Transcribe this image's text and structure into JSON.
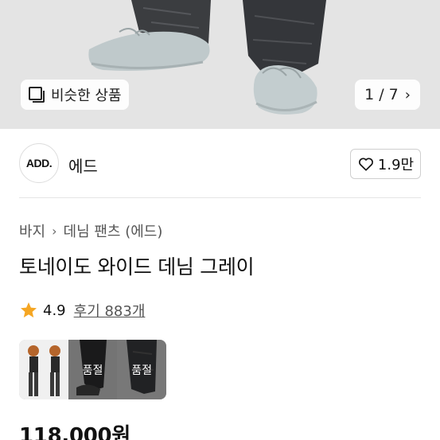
{
  "gallery": {
    "similar_label": "비슷한 상품",
    "pager": "1 / 7",
    "pager_icon": "chevron-right-icon"
  },
  "brand": {
    "logo_text": "ADD.",
    "name": "에드",
    "like_count": "1.9만",
    "like_icon": "heart-outline-icon"
  },
  "breadcrumb": {
    "level1": "바지",
    "level2": "데님 팬츠 (에드)"
  },
  "product": {
    "title": "토네이도 와이드 데님 그레이",
    "rating": "4.9",
    "reviews": "후기 883개",
    "star_color": "#f5a623",
    "price": "118,000원"
  },
  "variants": [
    {
      "label": ""
    },
    {
      "label": "품절"
    },
    {
      "label": "품절"
    }
  ]
}
